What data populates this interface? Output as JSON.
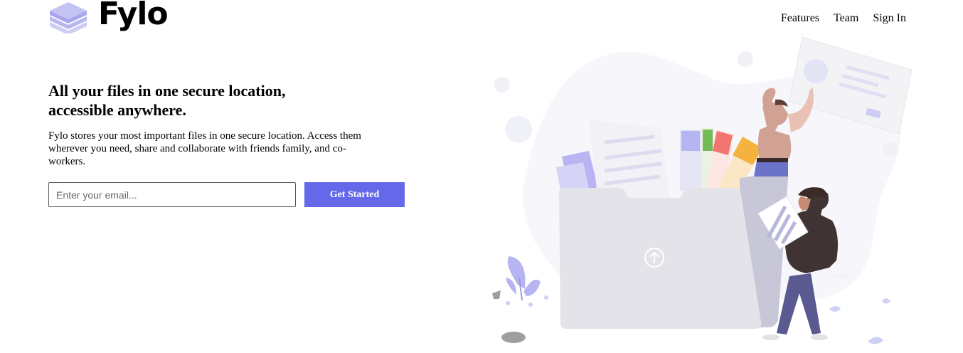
{
  "brand": {
    "name": "Fylo",
    "accent_color": "#6668ea",
    "logo_icon": "stacked-layers-icon"
  },
  "nav": {
    "items": [
      {
        "label": "Features"
      },
      {
        "label": "Team"
      },
      {
        "label": "Sign In"
      }
    ]
  },
  "hero": {
    "title": "All your files in one secure location, accessible anywhere.",
    "description": "Fylo stores your most important files in one secure location. Access them wherever you need, share and collaborate with friends family, and co-workers.",
    "email_placeholder": "Enter your email...",
    "cta_label": "Get Started",
    "illustration": "file-folder-upload-illustration"
  }
}
